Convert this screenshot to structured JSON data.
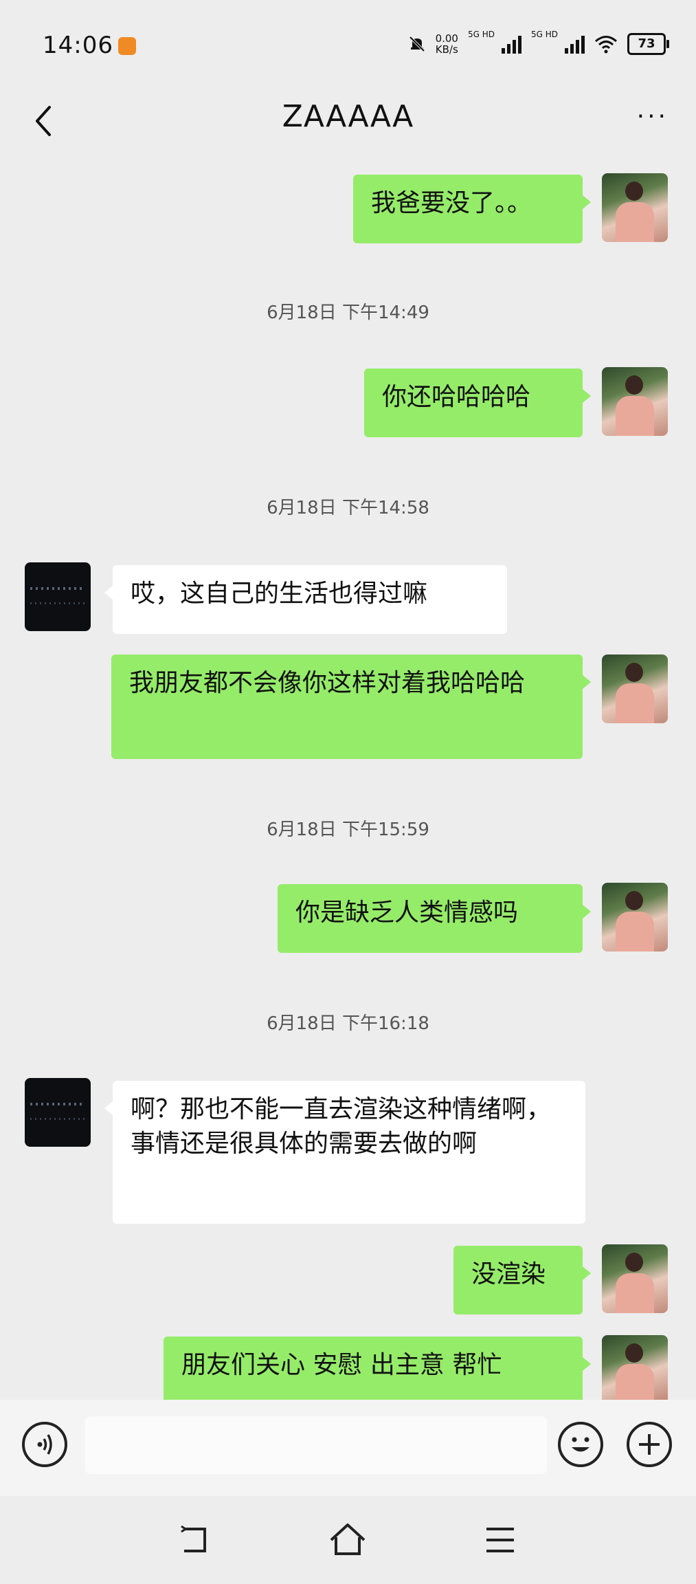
{
  "status_bar": {
    "time": "14:06",
    "net_speed_value": "0.00",
    "net_speed_unit": "KB/s",
    "sim1_label": "5G HD",
    "sim2_label": "5G HD",
    "battery": "73"
  },
  "header": {
    "title": "ZAAAAA",
    "more_label": "···"
  },
  "messages": [
    {
      "type": "me",
      "text": "我爸要没了。。"
    },
    {
      "type": "time",
      "text": "6月18日 下午14:49"
    },
    {
      "type": "me",
      "text": "你还哈哈哈哈"
    },
    {
      "type": "time",
      "text": "6月18日 下午14:58"
    },
    {
      "type": "other",
      "text": "哎，这自己的生活也得过嘛"
    },
    {
      "type": "me",
      "text": "我朋友都不会像你这样对着我哈哈哈"
    },
    {
      "type": "time",
      "text": "6月18日 下午15:59"
    },
    {
      "type": "me",
      "text": "你是缺乏人类情感吗"
    },
    {
      "type": "time",
      "text": "6月18日 下午16:18"
    },
    {
      "type": "other",
      "text": "啊？那也不能一直去渲染这种情绪啊，事情还是很具体的需要去做的啊"
    },
    {
      "type": "me",
      "text": "没渲染"
    },
    {
      "type": "me",
      "text": "朋友们关心 安慰 出主意 帮忙"
    }
  ],
  "colors": {
    "background": "#ededed",
    "my_bubble": "#95ec69",
    "other_bubble": "#ffffff"
  }
}
